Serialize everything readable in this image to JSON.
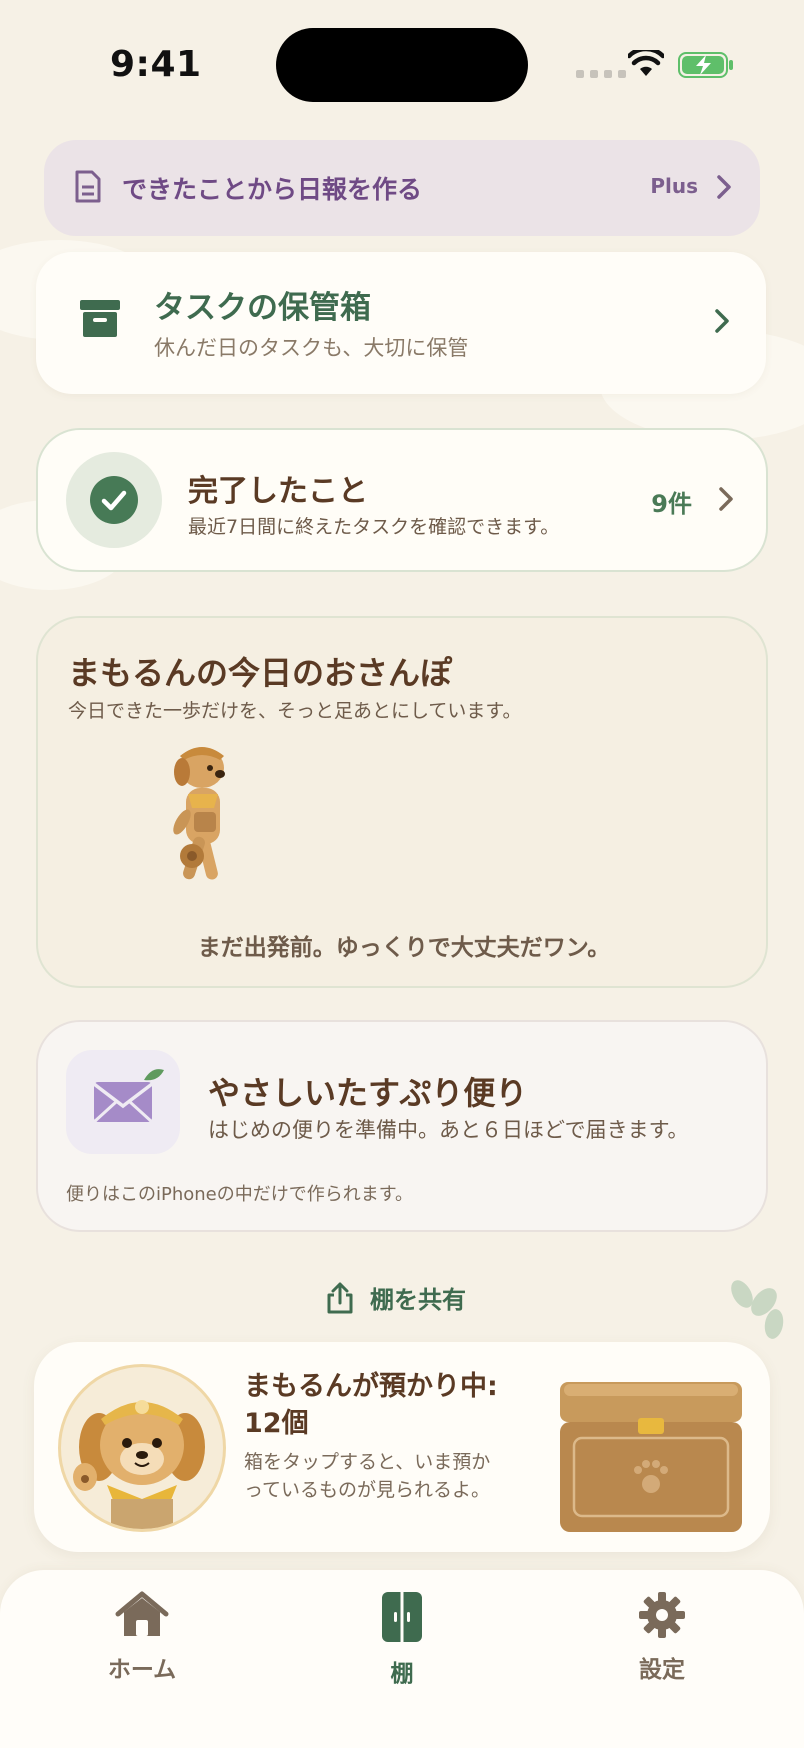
{
  "status": {
    "time": "9:41"
  },
  "banner": {
    "text": "できたことから日報を作る",
    "badge": "Plus"
  },
  "storage": {
    "title": "タスクの保管箱",
    "subtitle": "休んだ日のタスクも、大切に保管"
  },
  "completed": {
    "title": "完了したこと",
    "subtitle": "最近7日間に終えたタスクを確認できます。",
    "count": "9件"
  },
  "walk": {
    "title": "まもるんの今日のおさんぽ",
    "subtitle": "今日できた一歩だけを、そっと足あとにしています。",
    "message": "まだ出発前。ゆっくりで大丈夫だワン。"
  },
  "letter": {
    "title": "やさしいたすぷり便り",
    "subtitle": "はじめの便りを準備中。あと６日ほどで届きます。",
    "note": "便りはこのiPhoneの中だけで作られます。"
  },
  "share": {
    "label": "棚を共有"
  },
  "keeping": {
    "title": "まもるんが預かり中: 12個",
    "subtitle": "箱をタップすると、いま預かっているものが見られるよ。"
  },
  "tabs": [
    {
      "label": "ホーム",
      "icon": "home-icon"
    },
    {
      "label": "棚",
      "icon": "shelf-icon"
    },
    {
      "label": "設定",
      "icon": "gear-icon"
    }
  ],
  "colors": {
    "accent_green": "#3f6b4f",
    "brown_text": "#5a3a24",
    "plus_purple": "#6f4a85",
    "background": "#f6f1e6"
  }
}
